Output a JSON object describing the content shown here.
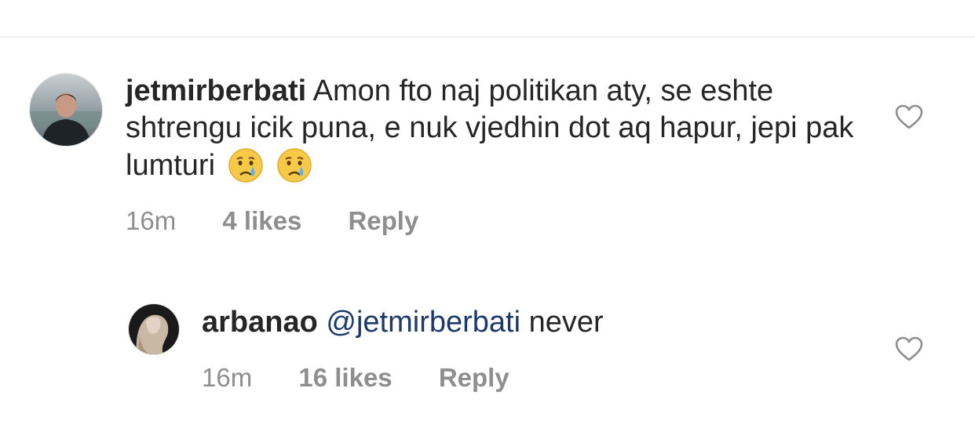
{
  "comments": [
    {
      "username": "jetmirberbati",
      "text": "Amon fto naj politikan aty, se eshte shtrengu icik puna, e nuk vjedhin dot aq hapur, jepi pak lumturi",
      "emojis": [
        "crying-face",
        "crying-face"
      ],
      "time": "16m",
      "likes": "4 likes",
      "reply_label": "Reply"
    },
    {
      "username": "arbanao",
      "mention": "@jetmirberbati",
      "text": "never",
      "time": "16m",
      "likes": "16 likes",
      "reply_label": "Reply"
    }
  ],
  "icons": {
    "like": "heart-outline-icon",
    "emoji": "crying-face-emoji"
  },
  "colors": {
    "text": "#262626",
    "meta": "#8e8e8e",
    "mention": "#1b3a6b",
    "emoji_fill": "#f7c948"
  }
}
